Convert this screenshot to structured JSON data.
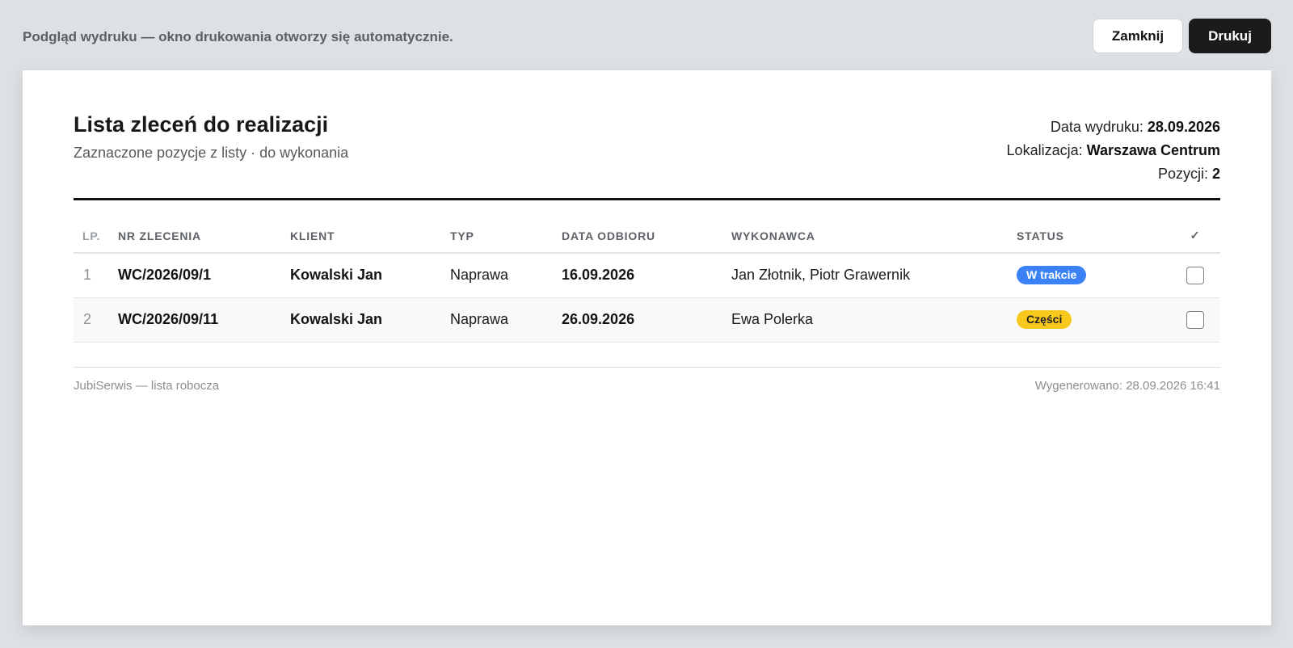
{
  "topbar": {
    "notice": "Podgląd wydruku — okno drukowania otworzy się automatycznie.",
    "close_label": "Zamknij",
    "print_label": "Drukuj"
  },
  "document": {
    "title": "Lista zleceń do realizacji",
    "subtitle": "Zaznaczone pozycje z listy · do wykonania",
    "meta": {
      "print_date_label": "Data wydruku:",
      "print_date": "28.09.2026",
      "location_label": "Lokalizacja:",
      "location": "Warszawa Centrum",
      "count_label": "Pozycji:",
      "count": "2"
    },
    "table": {
      "headers": {
        "lp": "LP.",
        "order_no": "NR ZLECENIA",
        "client": "KLIENT",
        "type": "TYP",
        "pickup_date": "DATA ODBIORU",
        "contractor": "WYKONAWCA",
        "status": "STATUS",
        "check": "✓"
      },
      "rows": [
        {
          "lp": "1",
          "order_no": "WC/2026/09/1",
          "client": "Kowalski Jan",
          "type": "Naprawa",
          "pickup_date": "16.09.2026",
          "contractor": "Jan Złotnik, Piotr Grawernik",
          "status": "W trakcie",
          "status_color": "#3b82f6",
          "checked": false
        },
        {
          "lp": "2",
          "order_no": "WC/2026/09/11",
          "client": "Kowalski Jan",
          "type": "Naprawa",
          "pickup_date": "26.09.2026",
          "contractor": "Ewa Polerka",
          "status": "Części",
          "status_color": "#f8c91c",
          "checked": false
        }
      ]
    },
    "footer": {
      "left": "JubiSerwis — lista robocza",
      "right": "Wygenerowano: 28.09.2026 16:41"
    }
  }
}
